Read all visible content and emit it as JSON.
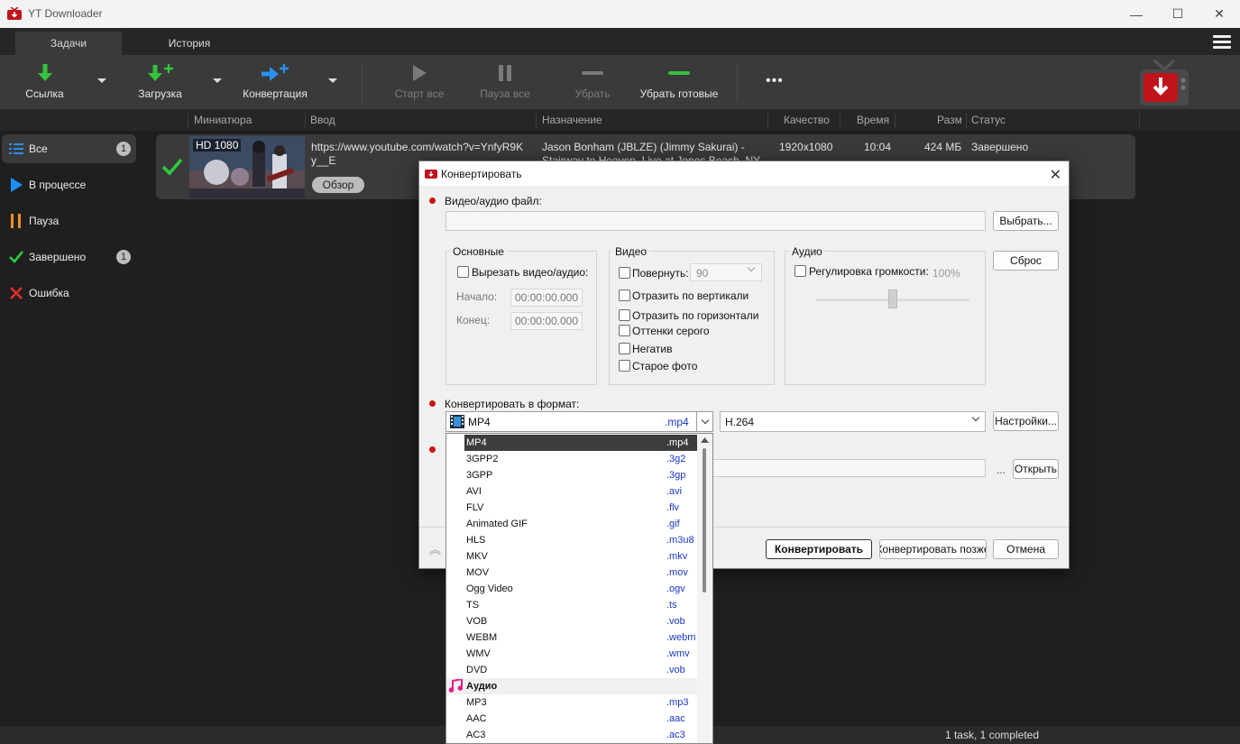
{
  "window": {
    "title": "YT Downloader",
    "minimize": "—",
    "maximize": "☐",
    "close": "✕"
  },
  "tabs": [
    "Задачи",
    "История"
  ],
  "toolbar": {
    "link": "Ссылка",
    "download": "Загрузка",
    "convert": "Конвертация",
    "start_all": "Старт все",
    "pause_all": "Пауза все",
    "remove": "Убрать",
    "remove_done": "Убрать готовые",
    "more": "•••"
  },
  "columns": {
    "thumb": "Миниатюра",
    "input": "Ввод",
    "dest": "Назначение",
    "quality": "Качество",
    "time": "Время",
    "size": "Разм",
    "status": "Статус"
  },
  "sidebar": {
    "items": [
      {
        "label": "Все",
        "badge": "1"
      },
      {
        "label": "В процессе"
      },
      {
        "label": "Пауза"
      },
      {
        "label": "Завершено",
        "badge": "1"
      },
      {
        "label": "Ошибка"
      }
    ]
  },
  "task": {
    "badge": "HD 1080",
    "url_line1": "https://www.youtube.com/watch?v=YnfyR9K",
    "url_line2": "y__E",
    "browse": "Обзор",
    "dest_line1": "Jason Bonham (JBLZE) (Jimmy Sakurai) -",
    "dest_line2": "Stairway to Heaven, Live at Jones Beach, NY",
    "quality": "1920x1080",
    "time": "10:04",
    "size": "424 МБ",
    "status": "Завершено"
  },
  "statusbar": {
    "text": "1 task, 1 completed"
  },
  "dialog": {
    "title": "Конвертировать",
    "close": "✕",
    "file_label": "Видео/аудио файл:",
    "choose": "Выбрать...",
    "reset": "Сброс",
    "basic": {
      "title": "Основные",
      "cut": "Вырезать видео/аудио:",
      "start_label": "Начало:",
      "end_label": "Конец:",
      "start_value": "00:00:00.000",
      "end_value": "00:00:00.000"
    },
    "video": {
      "title": "Видео",
      "rotate": "Повернуть:",
      "rotate_value": "90",
      "flip_v": "Отразить по вертикали",
      "flip_h": "Отразить по горизонтали",
      "gray": "Оттенки серого",
      "negative": "Негатив",
      "old": "Старое фото"
    },
    "audio": {
      "title": "Аудио",
      "volume": "Регулировка громкости:",
      "volume_value": "100%",
      "volume_level": 0.5
    },
    "format_label": "Конвертировать в формат:",
    "format_value": "MP4",
    "format_ext": ".mp4",
    "codec_value": "H.264",
    "settings": "Настройки...",
    "dots": "...",
    "open": "Открыть",
    "convert": "Конвертировать",
    "convert_later": "Конвертировать позже",
    "cancel": "Отмена"
  },
  "format_list": [
    {
      "name": "MP4",
      "ext": ".mp4",
      "selected": true
    },
    {
      "name": "3GPP2",
      "ext": ".3g2"
    },
    {
      "name": "3GPP",
      "ext": ".3gp"
    },
    {
      "name": "AVI",
      "ext": ".avi"
    },
    {
      "name": "FLV",
      "ext": ".flv"
    },
    {
      "name": "Animated GIF",
      "ext": ".gif"
    },
    {
      "name": "HLS",
      "ext": ".m3u8"
    },
    {
      "name": "MKV",
      "ext": ".mkv"
    },
    {
      "name": "MOV",
      "ext": ".mov"
    },
    {
      "name": "Ogg Video",
      "ext": ".ogv"
    },
    {
      "name": "TS",
      "ext": ".ts"
    },
    {
      "name": "VOB",
      "ext": ".vob"
    },
    {
      "name": "WEBM",
      "ext": ".webm"
    },
    {
      "name": "WMV",
      "ext": ".wmv"
    },
    {
      "name": "DVD",
      "ext": ".vob"
    },
    {
      "name": "Аудио",
      "ext": "",
      "header": true
    },
    {
      "name": "MP3",
      "ext": ".mp3"
    },
    {
      "name": "AAC",
      "ext": ".aac"
    },
    {
      "name": "AC3",
      "ext": ".ac3"
    }
  ],
  "colors": {
    "accent_green": "#2ecc40",
    "accent_blue": "#1e90ff",
    "accent_orange": "#f0902a",
    "error_red": "#e03030"
  }
}
